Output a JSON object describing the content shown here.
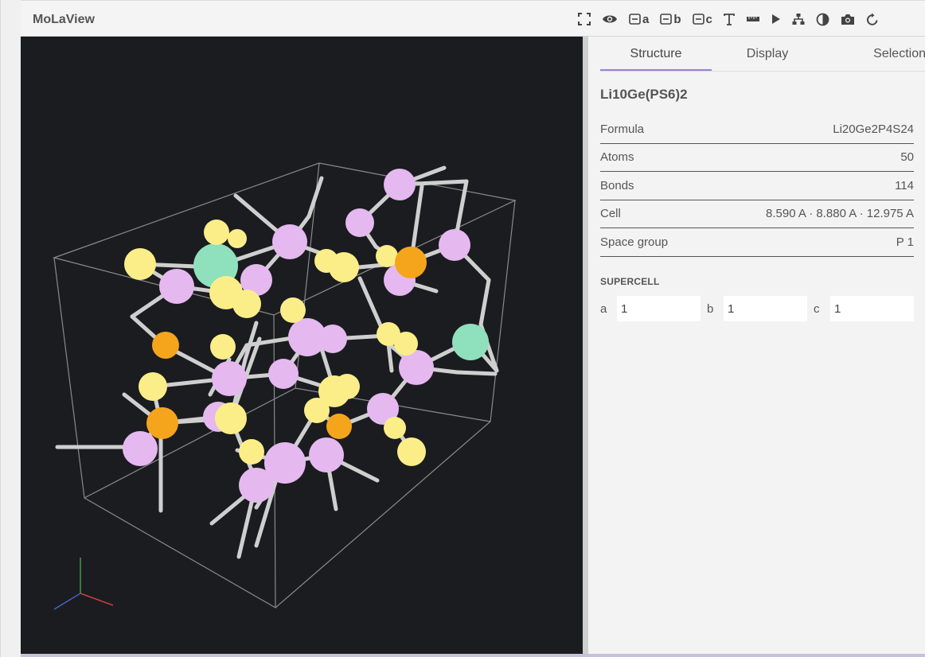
{
  "app": {
    "title": "MoLaView"
  },
  "toolbar": {
    "cell_a_label": "a",
    "cell_b_label": "b",
    "cell_c_label": "c"
  },
  "tabs": [
    {
      "label": "Structure",
      "active": true
    },
    {
      "label": "Display",
      "active": false
    },
    {
      "label": "Selection",
      "active": false
    }
  ],
  "structure": {
    "name": "Li10Ge(PS6)2",
    "properties": [
      {
        "key": "Formula",
        "value": "Li20Ge2P4S24"
      },
      {
        "key": "Atoms",
        "value": "50"
      },
      {
        "key": "Bonds",
        "value": "114"
      },
      {
        "key": "Cell",
        "value": "8.590 A · 8.880 A · 12.975 A"
      },
      {
        "key": "Space group",
        "value": "P 1"
      }
    ],
    "supercell": {
      "title": "SUPERCELL",
      "a_label": "a",
      "a_value": "1",
      "b_label": "b",
      "b_value": "1",
      "c_label": "c",
      "c_value": "1"
    }
  },
  "colors": {
    "li": "#e5b8f0",
    "s": "#fbee88",
    "p": "#f5a51c",
    "ge": "#8fe0bd",
    "bond": "#d6d6d6",
    "accent": "#9b7fd4"
  }
}
